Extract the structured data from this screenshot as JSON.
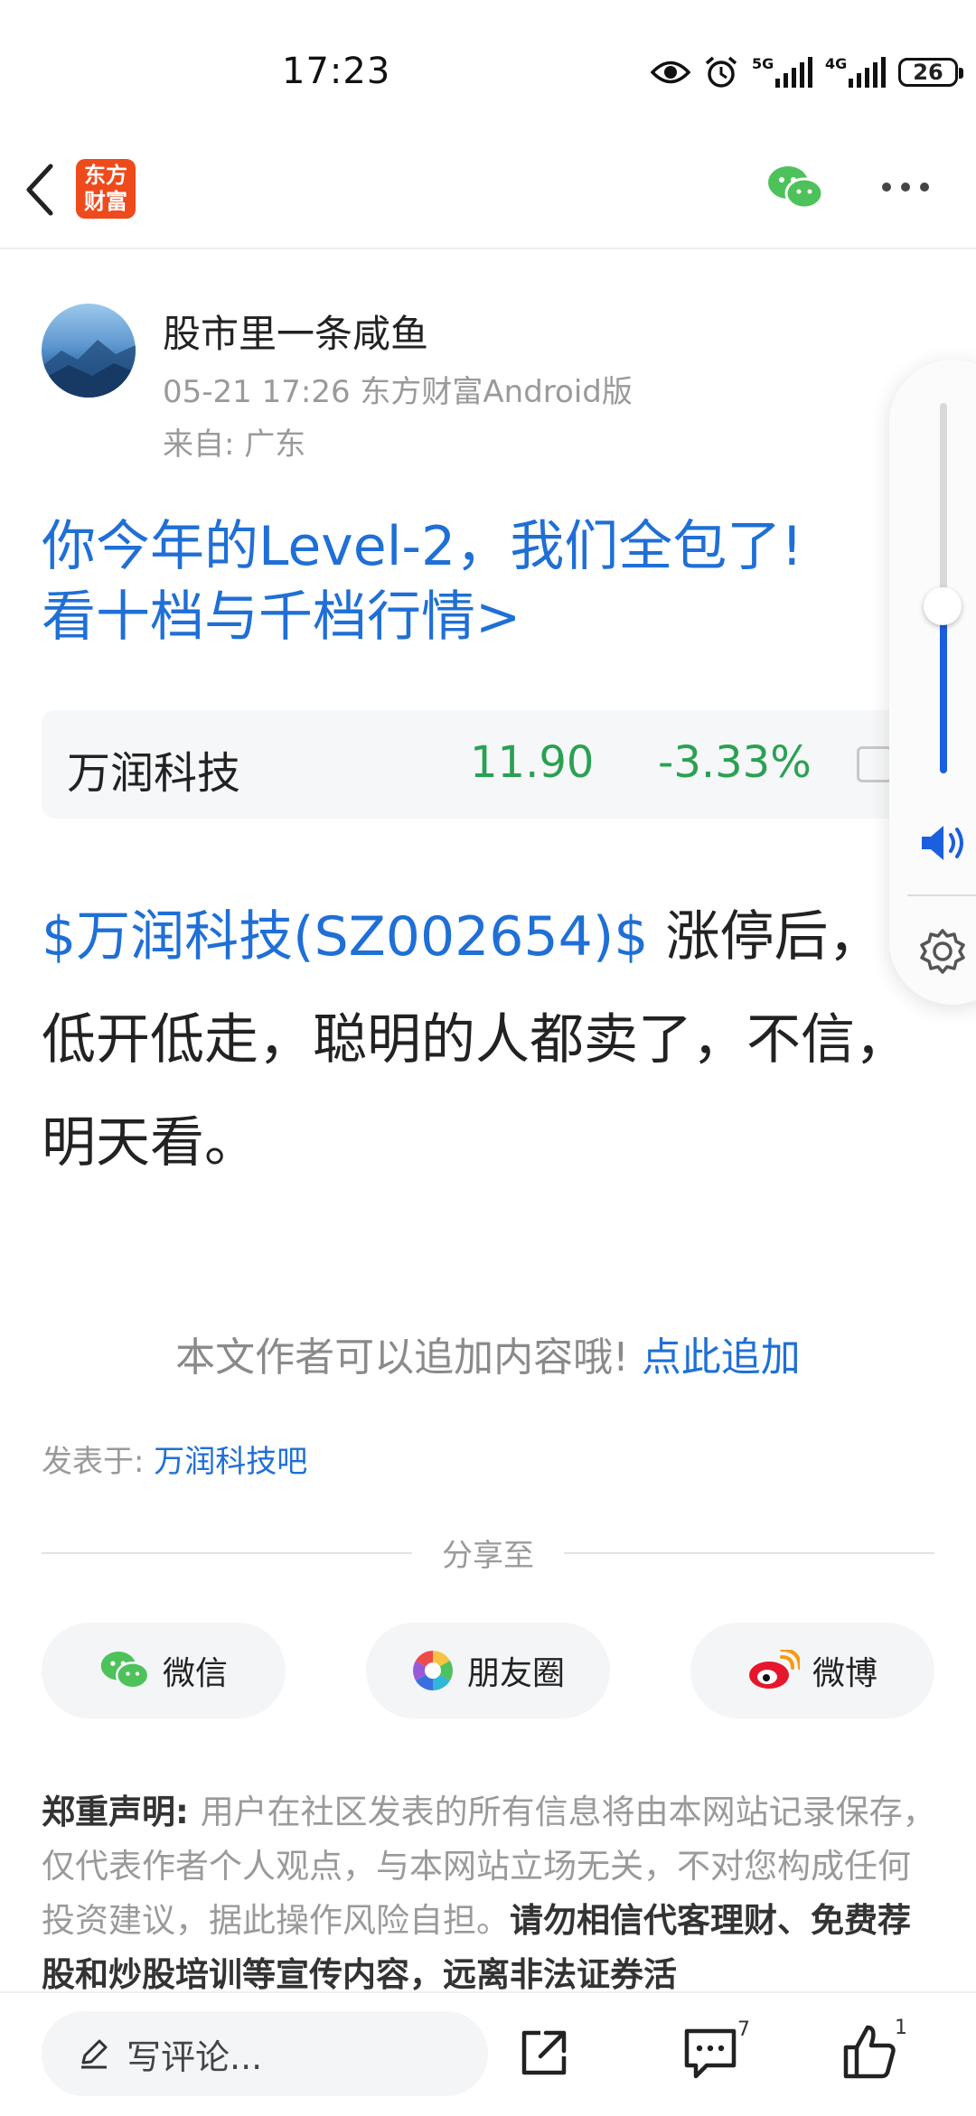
{
  "status_bar": {
    "time": "17:23",
    "signal_1_label": "5G",
    "signal_2_label": "4G",
    "battery": "26",
    "icons": [
      "eye-icon",
      "alarm-icon"
    ]
  },
  "nav": {
    "back_icon": "chevron-left-icon",
    "logo_text_line1": "东方",
    "logo_text_line2": "财富",
    "wechat_icon": "wechat-icon",
    "more_icon": "more-icon"
  },
  "author": {
    "name": "股市里一条咸鱼",
    "meta": "05-21 17:26 东方财富Android版",
    "location": "来自: 广东"
  },
  "promo": {
    "line1": "你今年的Level-2，我们全包了!",
    "line2": "看十档与千档行情>"
  },
  "stock_card": {
    "name": "万润科技",
    "price": "11.90",
    "change": "-3.33%"
  },
  "post": {
    "tag": "$万润科技(SZ002654)$",
    "text": " 涨停后，低开低走，聪明的人都卖了，不信，明天看。"
  },
  "append": {
    "prompt": "本文作者可以追加内容哦!",
    "link": "点此追加"
  },
  "posted_in": {
    "label": "发表于: ",
    "board": "万润科技吧"
  },
  "share": {
    "title": "分享至",
    "wechat": "微信",
    "moments": "朋友圈",
    "weibo": "微博"
  },
  "disclaimer": {
    "title": "郑重声明",
    "colon": ": ",
    "text": "用户在社区发表的所有信息将由本网站记录保存，仅代表作者个人观点，与本网站立场无关，不对您构成任何投资建议，据此操作风险自担。",
    "strong": "请勿相信代客理财、免费荐股和炒股培训等宣传内容，远离非法证券活"
  },
  "bottom_bar": {
    "comment_placeholder": "写评论...",
    "comment_count": "7",
    "like_count": "1"
  },
  "volume": {
    "level": 0.45
  },
  "colors": {
    "link_blue": "#1f6fd6",
    "stock_green": "#2aa152",
    "brand_orange": "#ee4a1b",
    "volume_blue": "#1a5fe0"
  }
}
